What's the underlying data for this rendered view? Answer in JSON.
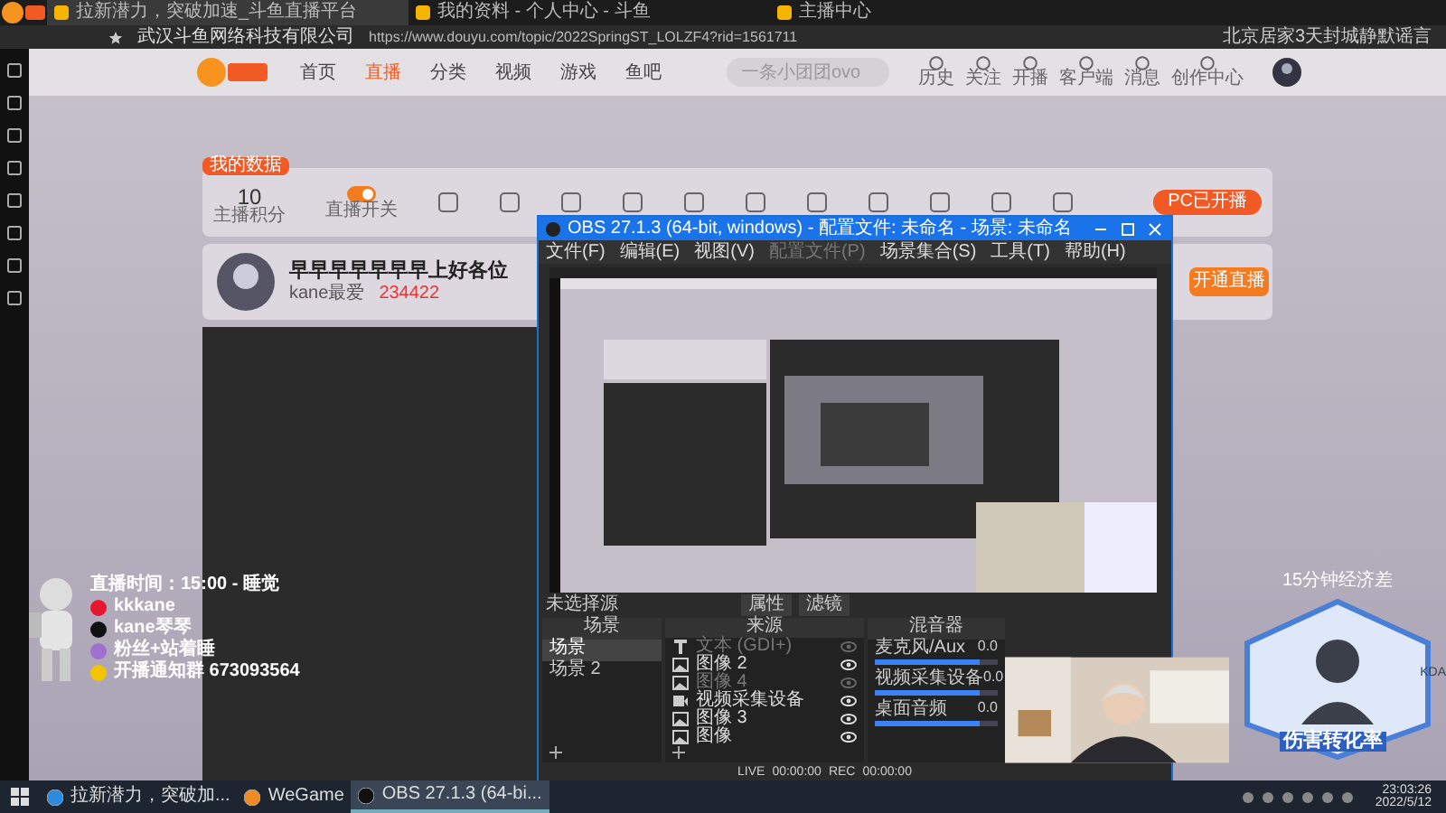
{
  "browser": {
    "tabs": [
      {
        "title": "拉新潜力，突破加速_斗鱼直播平台",
        "selected": true
      },
      {
        "title": "我的资料 - 个人中心 - 斗鱼",
        "selected": false
      },
      {
        "title": "主播中心",
        "selected": false
      }
    ],
    "company": "武汉斗鱼网络科技有限公司",
    "url": "https://www.douyu.com/topic/2022SpringST_LOLZF4?rid=1561711",
    "news": "北京居家3天封城静默谣言"
  },
  "site": {
    "nav": [
      {
        "label": "首页",
        "selected": false
      },
      {
        "label": "直播",
        "selected": true
      },
      {
        "label": "分类",
        "selected": false
      },
      {
        "label": "视频",
        "selected": false
      },
      {
        "label": "游戏",
        "selected": false
      },
      {
        "label": "鱼吧",
        "selected": false
      }
    ],
    "search": {
      "placeholder": "一条小团团ovo"
    },
    "header_links": [
      "历史",
      "关注",
      "开播",
      "客户端",
      "消息",
      "创作中心"
    ]
  },
  "dashboard": {
    "badge": "我的数据",
    "score": "10",
    "score_label": "主播积分",
    "switch_label": "直播开关",
    "switch_on": true,
    "pc_button": "PC已开播"
  },
  "streamer": {
    "title": "早早早早早早早上好各位",
    "name": "kane最爱",
    "hot": "234422",
    "button": "开通直播"
  },
  "obs": {
    "title": "OBS 27.1.3 (64-bit, windows) - 配置文件: 未命名 - 场景: 未命名",
    "menu": [
      {
        "label": "文件(F)",
        "disabled": false
      },
      {
        "label": "编辑(E)",
        "disabled": false
      },
      {
        "label": "视图(V)",
        "disabled": false
      },
      {
        "label": "配置文件(P)",
        "disabled": true
      },
      {
        "label": "场景集合(S)",
        "disabled": false
      },
      {
        "label": "工具(T)",
        "disabled": false
      },
      {
        "label": "帮助(H)",
        "disabled": false
      }
    ],
    "source_bar": {
      "label": "未选择源",
      "buttons": [
        "属性",
        "滤镜"
      ]
    },
    "scenes": {
      "title": "场景",
      "items": [
        {
          "label": "场景",
          "selected": true
        },
        {
          "label": "场景 2",
          "selected": false
        }
      ]
    },
    "sources": {
      "title": "来源",
      "items": [
        {
          "label": "文本 (GDI+)",
          "kind": "text",
          "visible": false
        },
        {
          "label": "图像 2",
          "visible": true
        },
        {
          "label": "图像 4",
          "visible": false
        },
        {
          "label": "视频采集设备",
          "kind": "camera",
          "visible": true
        },
        {
          "label": "图像 3",
          "visible": true
        },
        {
          "label": "图像",
          "visible": true
        }
      ]
    },
    "mixer": {
      "title": "混音器",
      "channels": [
        {
          "name": "麦克风/Aux",
          "reading": "0.0",
          "level": 0.85
        },
        {
          "name": "视频采集设备",
          "reading": "0.0",
          "level": 0.85
        },
        {
          "name": "桌面音频",
          "reading": "0.0",
          "level": 0.85
        }
      ]
    },
    "status": [
      "LIVE",
      "00:00:00",
      "REC",
      "00:00:00"
    ]
  },
  "overlay_left": {
    "schedule": "直播时间：15:00 - 睡觉",
    "lines": [
      {
        "kind": "weibo",
        "text": "kkkane"
      },
      {
        "kind": "douyin",
        "text": "kane琴琴"
      },
      {
        "kind": "star",
        "text": "粉丝+站着睡"
      },
      {
        "kind": "qq",
        "text": "开播通知群 673093564"
      }
    ]
  },
  "overlay_right": {
    "top": "15分钟经济差",
    "title": "伤害转化率",
    "side": "KDA"
  },
  "taskbar": {
    "apps": [
      {
        "label": "拉新潜力，突破加...",
        "kind": "browser",
        "active": false
      },
      {
        "label": "WeGame",
        "kind": "wegame",
        "active": false
      },
      {
        "label": "OBS 27.1.3 (64-bi...",
        "kind": "obs",
        "active": true
      }
    ],
    "time": "23:03:26",
    "date": "2022/5/12"
  }
}
